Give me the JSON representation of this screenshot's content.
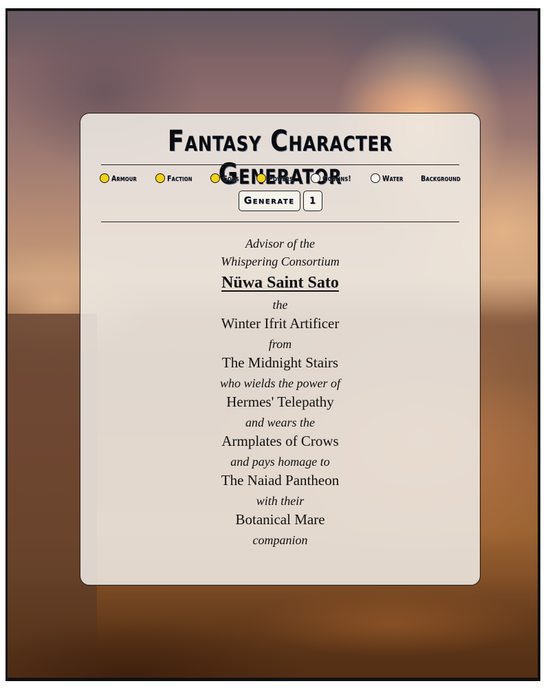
{
  "app": {
    "title": "Fantasy Character Generator"
  },
  "options": [
    {
      "label": "Armour",
      "checked": true
    },
    {
      "label": "Faction",
      "checked": true
    },
    {
      "label": "Gods",
      "checked": true
    },
    {
      "label": "Powers",
      "checked": true
    },
    {
      "label": "Goblins!",
      "checked": false
    },
    {
      "label": "Water",
      "checked": false
    },
    {
      "label": "Background",
      "checked": null
    }
  ],
  "controls": {
    "generate_label": "Generate",
    "count_value": "1"
  },
  "colors": {
    "checked_radio": "#f2d11a",
    "card_bg": "#eee9e4",
    "text": "#111111"
  },
  "character": {
    "role_line1": "Advisor of the",
    "role_line2": "Whispering Consortium",
    "name": "Nüwa Saint Sato",
    "connector_the": "the",
    "race_class": "Winter Ifrit Artificer",
    "connector_from": "from",
    "origin": "The Midnight Stairs",
    "connector_power": "who wields the power of",
    "power": "Hermes' Telepathy",
    "connector_wears": "and wears the",
    "armour": "Armplates of Crows",
    "connector_homage": "and pays homage to",
    "gods": "The Naiad Pantheon",
    "connector_with": "with their",
    "companion": "Botanical Mare",
    "connector_companion": "companion"
  }
}
